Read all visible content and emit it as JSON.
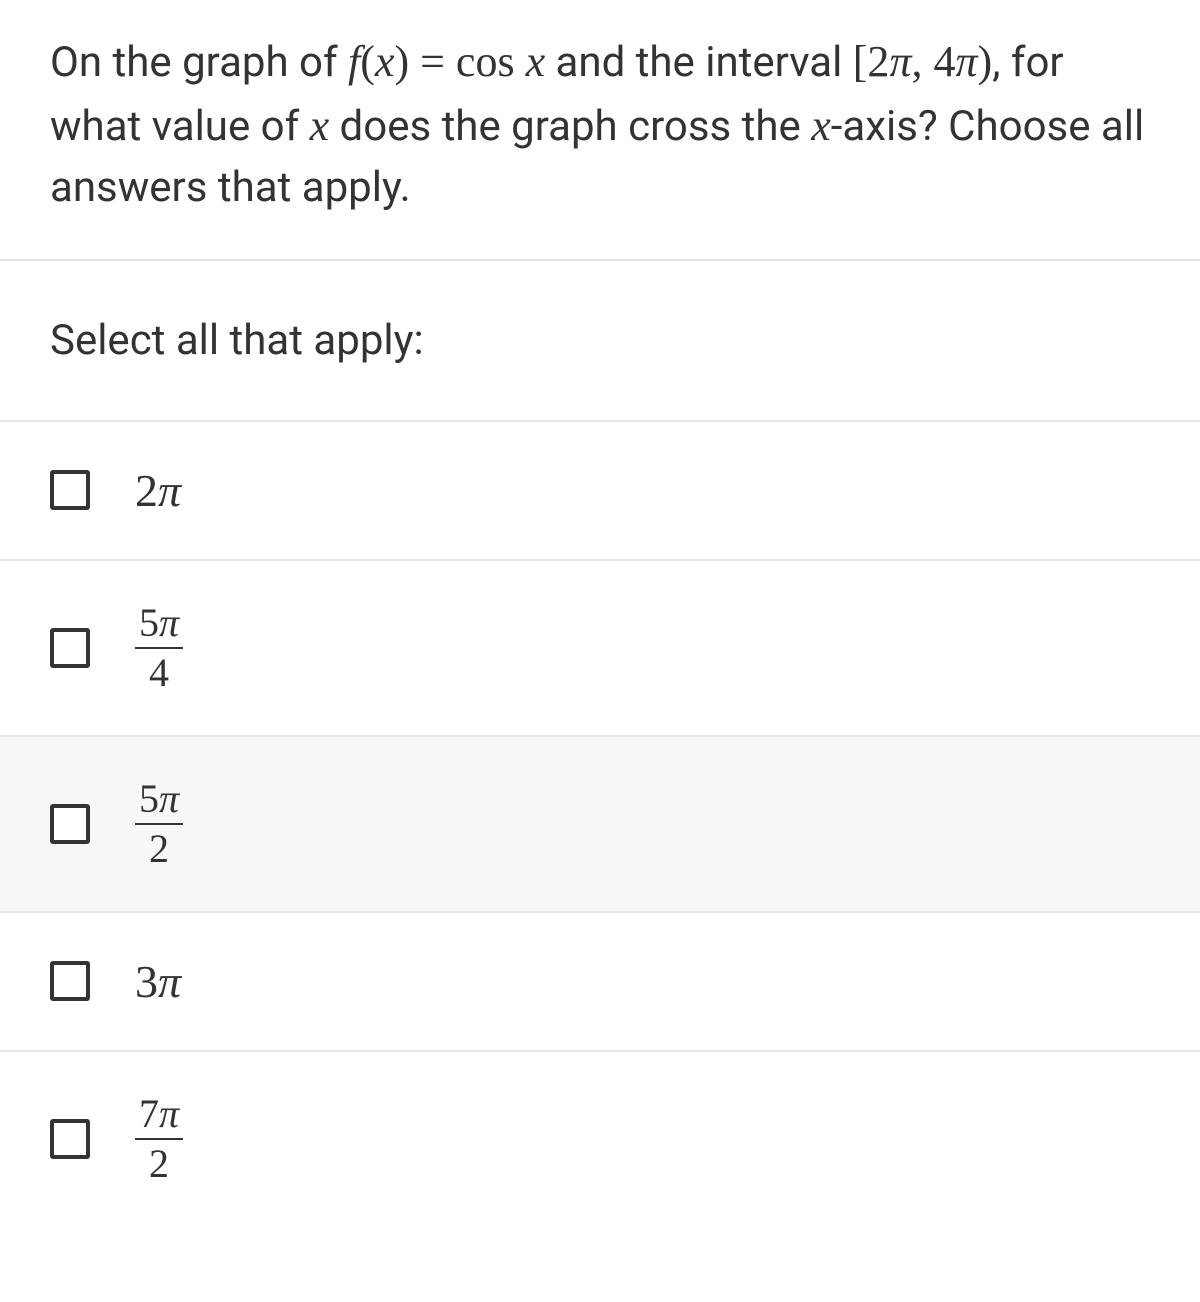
{
  "question": {
    "part1": "On the graph of ",
    "fx": "f(x) = cos x",
    "part2": " and the interval ",
    "interval": "[2π, 4π)",
    "part3": ", for what value of ",
    "xvar": "x",
    "part4": " does the graph cross the ",
    "xaxis": "x",
    "part5": "-axis? Choose all answers that apply."
  },
  "instruction": "Select all that apply:",
  "options": [
    {
      "type": "simple",
      "coef": "2",
      "sym": "π",
      "highlighted": false
    },
    {
      "type": "fraction",
      "num_coef": "5",
      "num_sym": "π",
      "den": "4",
      "highlighted": false
    },
    {
      "type": "fraction",
      "num_coef": "5",
      "num_sym": "π",
      "den": "2",
      "highlighted": true
    },
    {
      "type": "simple",
      "coef": "3",
      "sym": "π",
      "highlighted": false
    },
    {
      "type": "fraction",
      "num_coef": "7",
      "num_sym": "π",
      "den": "2",
      "highlighted": false
    }
  ]
}
